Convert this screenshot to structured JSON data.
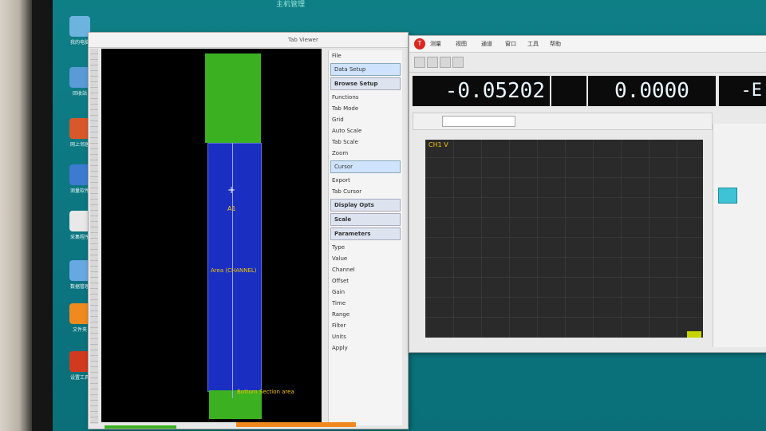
{
  "desktop": {
    "top_label": "主机管理",
    "icons": [
      {
        "label": "我的电脑",
        "color": "#6cb3e0"
      },
      {
        "label": "回收站",
        "color": "#5a9ad6"
      },
      {
        "label": "网上邻居",
        "color": "#d9582a"
      },
      {
        "label": "测量软件",
        "color": "#3d7bd1"
      },
      {
        "label": "采集程序",
        "color": "#e8e8e8"
      },
      {
        "label": "数据管理",
        "color": "#67a8e3"
      },
      {
        "label": "文件夹",
        "color": "#f08a1e"
      },
      {
        "label": "设置工具",
        "color": "#d23a1f"
      }
    ]
  },
  "left_window": {
    "title": "Tab Viewer",
    "annotations": {
      "top_label": "A1",
      "mid_label": "Area (CHANNEL)",
      "bottom_label": "Bottom Section area"
    },
    "panel": {
      "items": [
        {
          "label": "File",
          "type": "row"
        },
        {
          "label": "Data Setup",
          "type": "tag"
        },
        {
          "label": "Browse Setup",
          "type": "header"
        },
        {
          "label": "Functions",
          "type": "row"
        },
        {
          "label": "Tab Mode",
          "type": "row"
        },
        {
          "label": "Grid",
          "type": "row"
        },
        {
          "label": "Auto Scale",
          "type": "row"
        },
        {
          "label": "Tab Scale",
          "type": "row"
        },
        {
          "label": "Zoom",
          "type": "row"
        },
        {
          "label": "Cursor",
          "type": "tag"
        },
        {
          "label": "Export",
          "type": "row"
        },
        {
          "label": "Tab Cursor",
          "type": "row"
        },
        {
          "label": "Display Opts",
          "type": "header"
        },
        {
          "label": "Scale",
          "type": "header"
        },
        {
          "label": "Parameters",
          "type": "header"
        },
        {
          "label": "Type",
          "type": "row"
        },
        {
          "label": "Value",
          "type": "row"
        },
        {
          "label": "Channel",
          "type": "row"
        },
        {
          "label": "Offset",
          "type": "row"
        },
        {
          "label": "Gain",
          "type": "row"
        },
        {
          "label": "Time",
          "type": "row"
        },
        {
          "label": "Range",
          "type": "row"
        },
        {
          "label": "Filter",
          "type": "row"
        },
        {
          "label": "Units",
          "type": "row"
        },
        {
          "label": "Apply",
          "type": "row"
        }
      ]
    }
  },
  "right_window": {
    "menus": [
      "测量",
      "视图",
      "通道",
      "窗口",
      "工具",
      "帮助"
    ],
    "readouts": {
      "primary": "-0.05202",
      "secondary": "0.0000",
      "aux": "-E",
      "mini": ""
    },
    "graph": {
      "label": "CH1 V",
      "y_ticks": [
        "",
        "",
        "",
        "",
        "",
        "",
        "",
        "",
        "",
        ""
      ]
    }
  },
  "colors": {
    "desktop": "#0b7580",
    "plot_green": "#3bb021",
    "plot_blue": "#1a2fc2",
    "annotation": "#f3c500",
    "readout_bg": "#0b0b0b",
    "graph_bg": "#2a2a2a",
    "accent_cyan": "#3ec3d6"
  }
}
